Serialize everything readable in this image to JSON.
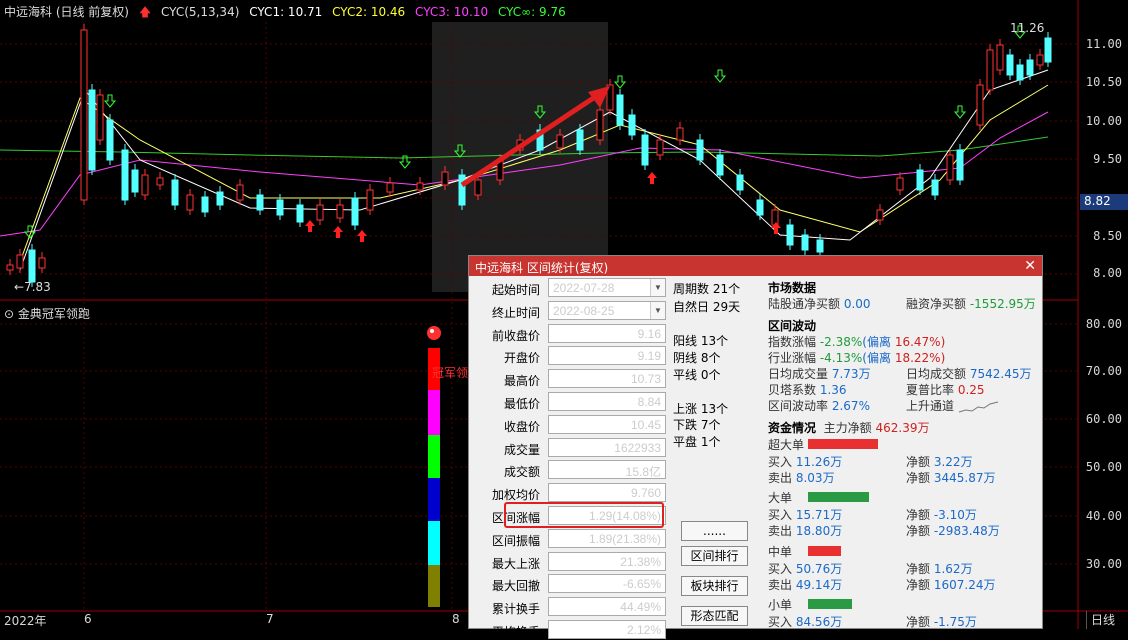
{
  "header": {
    "stock": "中远海科 (日线 前复权)",
    "indicator": "CYC(5,13,34)",
    "cyc1": "CYC1: 10.71",
    "cyc2": "CYC2: 10.46",
    "cyc3": "CYC3: 10.10",
    "cycinf": "CYC∞: 9.76"
  },
  "price_axis": [
    "11.00",
    "10.50",
    "10.00",
    "9.50",
    "8.50",
    "8.00"
  ],
  "current_price": "8.82",
  "high_label": "11.26",
  "low_label": "7.83",
  "sub_indicator": "金典冠军领跑",
  "sub_axis": [
    "80.00",
    "70.00",
    "60.00",
    "50.00",
    "40.00",
    "30.00"
  ],
  "sub_label": "冠军领",
  "x_axis": [
    "2022年",
    "6",
    "7",
    "8"
  ],
  "day_tab": "日线",
  "colors": {
    "up": "#ff3232",
    "down": "#54ffff",
    "accent": "#c8342f",
    "highlight": "#e02020"
  },
  "dialog": {
    "title": "中远海科  区间统计(复权)",
    "close": "✕",
    "fields": [
      {
        "label": "起始时间",
        "value": "2022-07-28",
        "dropdown": true
      },
      {
        "label": "终止时间",
        "value": "2022-08-25",
        "dropdown": true
      },
      {
        "label": "前收盘价",
        "value": "9.16"
      },
      {
        "label": "开盘价",
        "value": "9.19"
      },
      {
        "label": "最高价",
        "value": "10.73"
      },
      {
        "label": "最低价",
        "value": "8.84"
      },
      {
        "label": "收盘价",
        "value": "10.45"
      },
      {
        "label": "成交量",
        "value": "1622933"
      },
      {
        "label": "成交额",
        "value": "15.8亿"
      },
      {
        "label": "加权均价",
        "value": "9.760"
      },
      {
        "label": "区间涨幅",
        "value": "1.29(14.08%)"
      },
      {
        "label": "区间振幅",
        "value": "1.89(21.38%)"
      },
      {
        "label": "最大上涨",
        "value": "21.38%"
      },
      {
        "label": "最大回撤",
        "value": "-6.65%"
      },
      {
        "label": "累计换手",
        "value": "44.49%"
      },
      {
        "label": "平均换手",
        "value": "2.12%"
      }
    ],
    "mid": {
      "period": "周期数  21个",
      "natural": "自然日  29天",
      "yang": "阳线  13个",
      "yin": "阴线  8个",
      "flat": "平线  0个",
      "rise": "上涨  13个",
      "fall": "下跌  7个",
      "even": "平盘  1个"
    },
    "buttons": [
      "......",
      "区间排行",
      "板块排行",
      "形态匹配"
    ],
    "market": {
      "title": "市场数据",
      "hk_label": "陆股通净买额",
      "hk_value": "0.00",
      "margin_label": "融资净买额",
      "margin_value": "-1552.95万"
    },
    "volatility": {
      "title": "区间波动",
      "index_label": "指数涨幅",
      "index_value": "-2.38%",
      "index_dev_label": "(偏离",
      "index_dev": "16.47%)",
      "industry_label": "行业涨幅",
      "industry_value": "-4.13%",
      "industry_dev_label": "(偏离",
      "industry_dev": "18.22%)",
      "dvol_label": "日均成交量",
      "dvol_value": "7.73万",
      "damt_label": "日均成交额",
      "damt_value": "7542.45万",
      "beta_label": "贝塔系数",
      "beta_value": "1.36",
      "sharpe_label": "夏普比率",
      "sharpe_value": "0.25",
      "vrate_label": "区间波动率",
      "vrate_value": "2.67%",
      "trend_label": "上升通道"
    },
    "funds": {
      "title": "资金情况",
      "main_label": "主力净额",
      "main_value": "462.39万",
      "groups": [
        {
          "name": "超大单",
          "buy": "11.26万",
          "net": "3.22万",
          "sell": "8.03万",
          "net2": "3445.87万",
          "color": "#e83030",
          "bar": 0.55
        },
        {
          "name": "大单",
          "buy": "15.71万",
          "net": "-3.10万",
          "sell": "18.80万",
          "net2": "-2983.48万",
          "color": "#2a9a45",
          "bar": 0.48
        },
        {
          "name": "中单",
          "buy": "50.76万",
          "net": "1.62万",
          "sell": "49.14万",
          "net2": "1607.24万",
          "color": "#e83030",
          "bar": 0.26
        },
        {
          "name": "小单",
          "buy": "84.56万",
          "net": "-1.75万",
          "sell": "",
          "net2": "",
          "color": "#2a9a45",
          "bar": 0.34
        }
      ],
      "buy_label": "买入",
      "sell_label": "卖出",
      "net_label": "净额"
    }
  }
}
